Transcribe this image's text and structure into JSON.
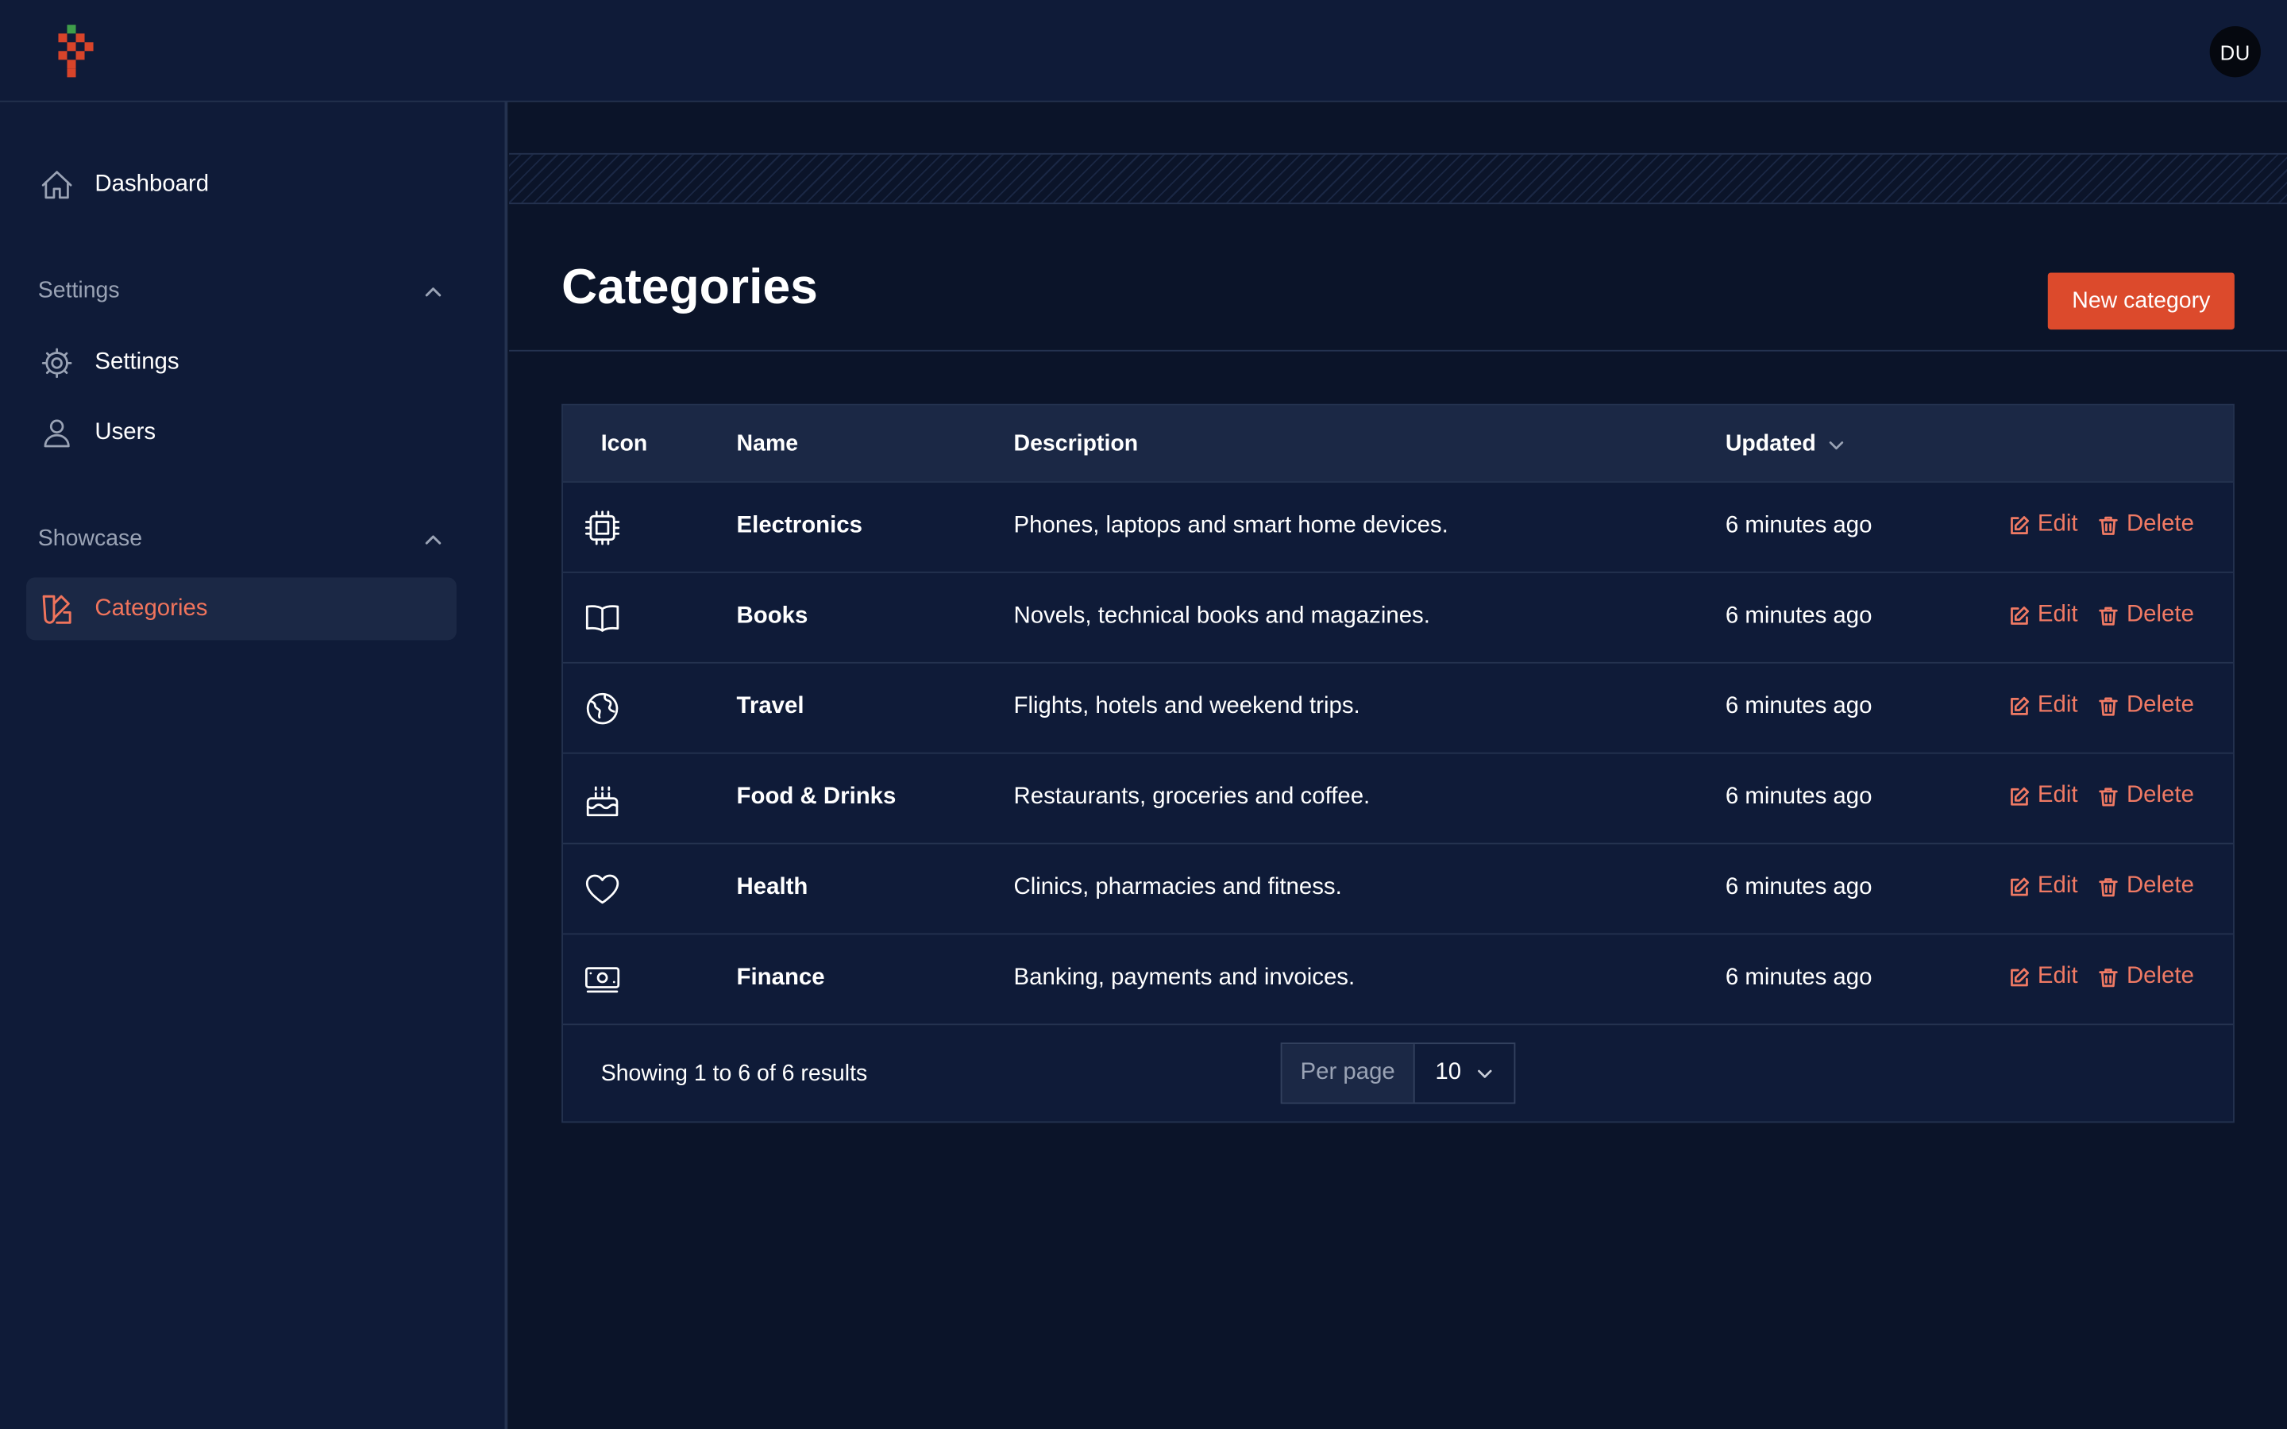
{
  "header": {
    "avatar_initials": "DU"
  },
  "colors": {
    "accent": "#dc4a2c",
    "accent_text": "#f07a64",
    "logo_green": "#3f9e4a",
    "background": "#0b1429",
    "panel": "#0f1b38"
  },
  "sidebar": {
    "dashboard": {
      "label": "Dashboard",
      "icon": "home-icon"
    },
    "groups": [
      {
        "label": "Settings",
        "items": [
          {
            "label": "Settings",
            "icon": "gear-icon"
          },
          {
            "label": "Users",
            "icon": "user-icon"
          }
        ]
      },
      {
        "label": "Showcase",
        "items": [
          {
            "label": "Categories",
            "icon": "swatch-icon",
            "active": true
          }
        ]
      }
    ]
  },
  "page": {
    "title": "Categories",
    "new_button": "New category"
  },
  "table": {
    "columns": {
      "icon": "Icon",
      "name": "Name",
      "description": "Description",
      "updated": "Updated"
    },
    "rows": [
      {
        "icon": "cpu-chip-icon",
        "name": "Electronics",
        "description": "Phones, laptops and smart home devices.",
        "updated": "6 minutes ago",
        "edit": "Edit",
        "delete": "Delete"
      },
      {
        "icon": "book-open-icon",
        "name": "Books",
        "description": "Novels, technical books and magazines.",
        "updated": "6 minutes ago",
        "edit": "Edit",
        "delete": "Delete"
      },
      {
        "icon": "globe-icon",
        "name": "Travel",
        "description": "Flights, hotels and weekend trips.",
        "updated": "6 minutes ago",
        "edit": "Edit",
        "delete": "Delete"
      },
      {
        "icon": "cake-icon",
        "name": "Food & Drinks",
        "description": "Restaurants, groceries and coffee.",
        "updated": "6 minutes ago",
        "edit": "Edit",
        "delete": "Delete"
      },
      {
        "icon": "heart-icon",
        "name": "Health",
        "description": "Clinics, pharmacies and fitness.",
        "updated": "6 minutes ago",
        "edit": "Edit",
        "delete": "Delete"
      },
      {
        "icon": "banknotes-icon",
        "name": "Finance",
        "description": "Banking, payments and invoices.",
        "updated": "6 minutes ago",
        "edit": "Edit",
        "delete": "Delete"
      }
    ],
    "footer": {
      "summary": "Showing 1 to 6 of 6 results",
      "per_page_label": "Per page",
      "per_page_value": "10"
    }
  }
}
